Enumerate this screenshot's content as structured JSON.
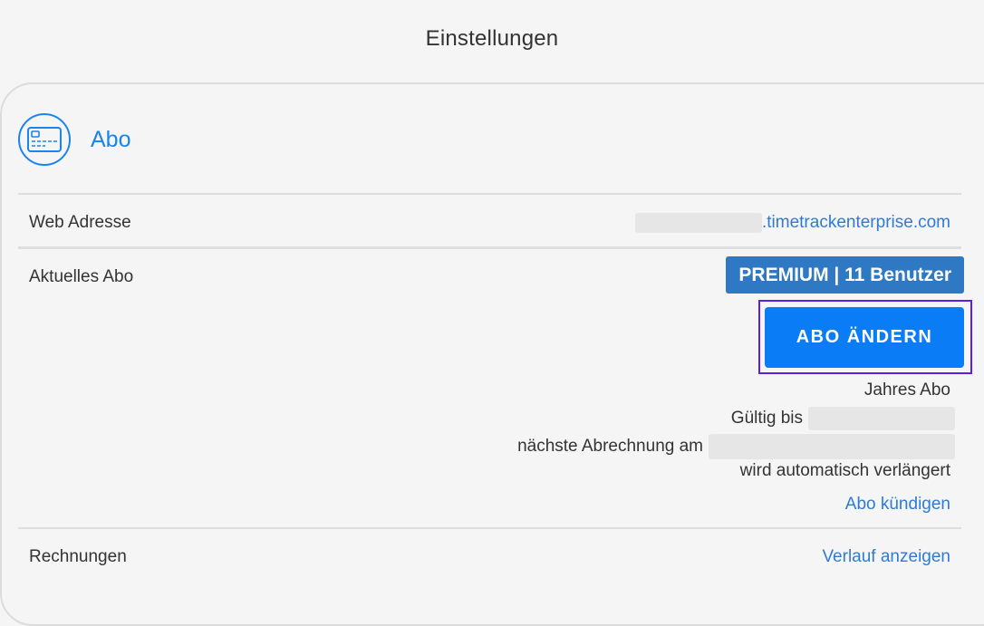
{
  "header": {
    "title": "Einstellungen"
  },
  "section": {
    "title": "Abo",
    "icon": "credit-card-icon"
  },
  "rows": {
    "web": {
      "label": "Web Adresse",
      "domain_suffix": ".timetrackenterprise.com"
    },
    "plan": {
      "label": "Aktuelles Abo",
      "badge": "PREMIUM | 11 Benutzer",
      "change_button": "ABO ÄNDERN",
      "period": "Jahres Abo",
      "valid_until_label": "Gültig bis",
      "next_billing_label": "nächste Abrechnung am",
      "auto_renew": "wird automatisch verlängert",
      "cancel_link": "Abo kündigen"
    },
    "invoices": {
      "label": "Rechnungen",
      "history_link": "Verlauf anzeigen"
    }
  },
  "colors": {
    "accent": "#1a84ee",
    "badge": "#2f78c4",
    "button": "#0a7cf5",
    "focus_frame": "#5b1ee6",
    "link": "#2e7bd6"
  }
}
